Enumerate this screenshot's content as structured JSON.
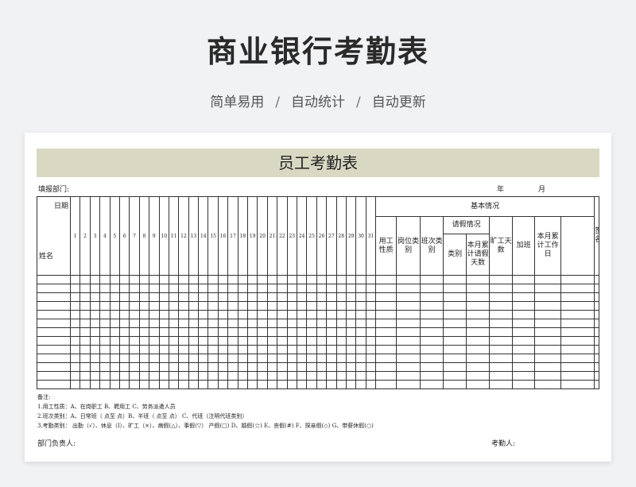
{
  "banner": {
    "title": "商业银行考勤表",
    "subtitle_parts": [
      "简单易用",
      "自动统计",
      "自动更新"
    ],
    "separator": "/"
  },
  "sheet": {
    "title": "员工考勤表",
    "dept_label": "填报部门:",
    "year_label": "年",
    "month_label": "月",
    "corner_date": "日期",
    "corner_name": "姓名",
    "days": [
      "1",
      "2",
      "3",
      "4",
      "5",
      "6",
      "7",
      "8",
      "9",
      "10",
      "11",
      "12",
      "13",
      "14",
      "15",
      "16",
      "17",
      "18",
      "19",
      "20",
      "21",
      "22",
      "23",
      "24",
      "25",
      "26",
      "27",
      "28",
      "29",
      "30",
      "31"
    ],
    "basic_info": "基本情况",
    "col_job_type": "用工性质",
    "col_position": "岗位类别",
    "col_shift": "班次类别",
    "leave_group": "请假情况",
    "col_leave_type": "类别",
    "col_leave_days": "本月累计请假天数",
    "col_absent": "旷工天数",
    "col_overtime": "加班",
    "col_workdays": "本月累计工作日",
    "col_sign": "签名",
    "body_rows": 13,
    "notes": [
      "备注:",
      "1.用工性质：A、在岗职工   B、聘用工  C、劳务派遣人员",
      "2.班次类别：A、日常班（   点至    点）B、半班（     点至     点） C、代班（注明代班类别）",
      "3.考勤类别：  出勤（√）、休息（I）、旷工（×）、病假(△）、事假(▽）    产假(□)       D、婚假(☆)      E、丧假(#)        F、探亲假(◇)       G、带薪休假(○)"
    ],
    "footer_left": "部门负责人:",
    "footer_right": "考勤人:"
  }
}
